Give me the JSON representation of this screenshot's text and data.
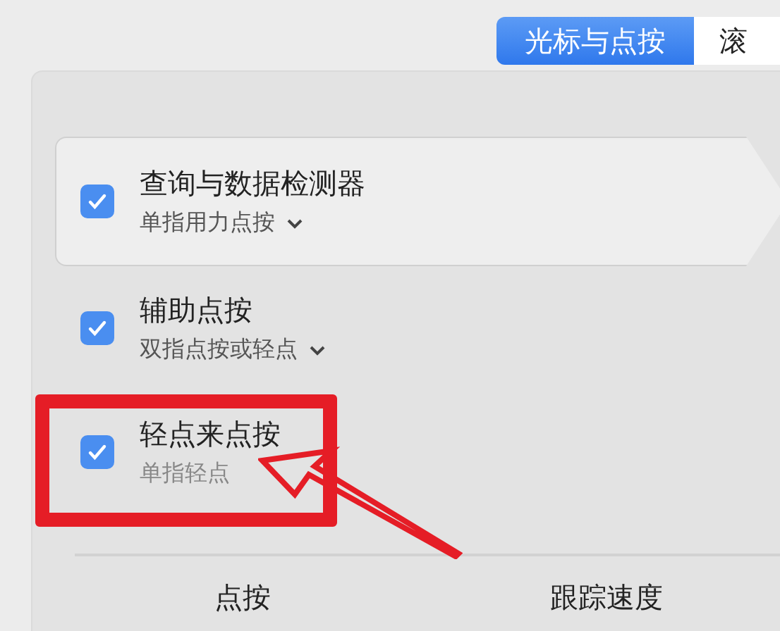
{
  "tabs": [
    {
      "label": "光标与点按",
      "selected": true
    },
    {
      "label": "滚",
      "selected": false
    }
  ],
  "options": [
    {
      "title": "查询与数据检测器",
      "subtitle": "单指用力点按",
      "checked": true,
      "dropdown": true,
      "highlighted": true,
      "annotated": false
    },
    {
      "title": "辅助点按",
      "subtitle": "双指点按或轻点",
      "checked": true,
      "dropdown": true,
      "highlighted": false,
      "annotated": false
    },
    {
      "title": "轻点来点按",
      "subtitle": "单指轻点",
      "checked": true,
      "dropdown": false,
      "highlighted": false,
      "annotated": true
    }
  ],
  "footer_labels": [
    "点按",
    "跟踪速度"
  ]
}
